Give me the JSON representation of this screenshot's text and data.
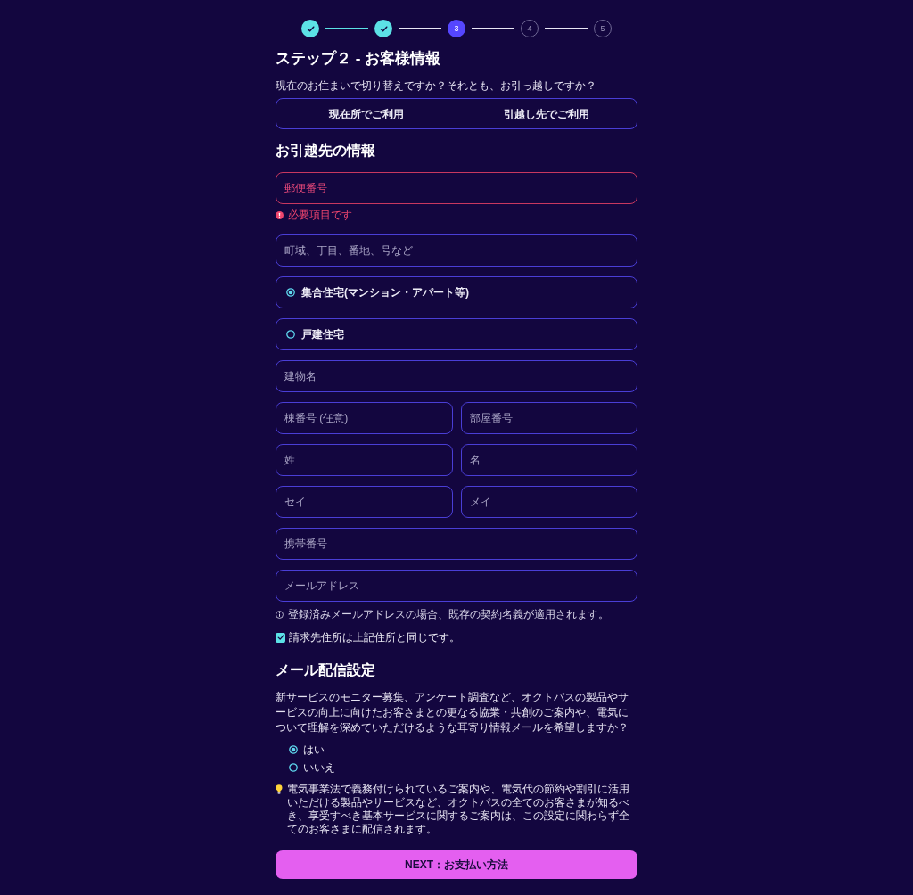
{
  "stepper": {
    "steps": [
      {
        "done": true,
        "current": false
      },
      {
        "done": true,
        "current": false
      },
      {
        "number": "3",
        "done": false,
        "current": true
      },
      {
        "number": "4",
        "done": false,
        "current": false
      },
      {
        "number": "5",
        "done": false,
        "current": false
      }
    ]
  },
  "title": "ステップ２ - お客様情報",
  "move_choice": {
    "question": "現在のお住まいで切り替えですか？それとも、お引っ越しですか？",
    "options": [
      {
        "label": "現在所でご利用",
        "selected": false
      },
      {
        "label": "引越し先でご利用",
        "selected": false
      }
    ]
  },
  "new_address": {
    "heading": "お引越先の情報",
    "rows": [
      {
        "kind": "inputs",
        "fields": [
          {
            "placeholder": "郵便番号",
            "invalid": true,
            "error": "必要項目です"
          }
        ]
      },
      {
        "kind": "inputs",
        "fields": [
          {
            "placeholder": "町域、丁目、番地、号など",
            "invalid": false
          }
        ]
      },
      {
        "kind": "radio",
        "label": "集合住宅(マンション・アパート等)",
        "selected": true
      },
      {
        "kind": "radio",
        "label": "戸建住宅",
        "selected": false
      },
      {
        "kind": "inputs",
        "fields": [
          {
            "placeholder": "建物名",
            "invalid": false
          }
        ]
      },
      {
        "kind": "inputs",
        "fields": [
          {
            "placeholder": "棟番号 (任意)",
            "invalid": false
          },
          {
            "placeholder": "部屋番号",
            "invalid": false
          }
        ]
      },
      {
        "kind": "inputs",
        "fields": [
          {
            "placeholder": "姓",
            "invalid": false
          },
          {
            "placeholder": "名",
            "invalid": false
          }
        ]
      },
      {
        "kind": "inputs",
        "fields": [
          {
            "placeholder": "セイ",
            "invalid": false
          },
          {
            "placeholder": "メイ",
            "invalid": false
          }
        ]
      },
      {
        "kind": "inputs",
        "fields": [
          {
            "placeholder": "携帯番号",
            "invalid": false
          }
        ]
      },
      {
        "kind": "inputs",
        "fields": [
          {
            "placeholder": "メールアドレス",
            "invalid": false
          }
        ]
      }
    ]
  },
  "email_note": "登録済みメールアドレスの場合、既存の契約名義が適用されます。",
  "billing_same_address": {
    "label": "請求先住所は上記住所と同じです。",
    "checked": true
  },
  "mail_settings": {
    "heading": "メール配信設定",
    "question": "新サービスのモニター募集、アンケート調査など、オクトパスの製品やサービスの向上に向けたお客さまとの更なる協業・共創のご案内や、電気について理解を深めていただけるような耳寄り情報メールを希望しますか？",
    "options": [
      {
        "label": "はい",
        "selected": true
      },
      {
        "label": "いいえ",
        "selected": false
      }
    ],
    "note": "電気事業法で義務付けられているご案内や、電気代の節約や割引に活用いただける製品やサービスなど、オクトパスの全てのお客さまが知るべき、享受すべき基本サービスに関するご案内は、この設定に関わらず全てのお客さまに配信されます。"
  },
  "next_button": {
    "label": "NEXT：お支払い方法"
  }
}
